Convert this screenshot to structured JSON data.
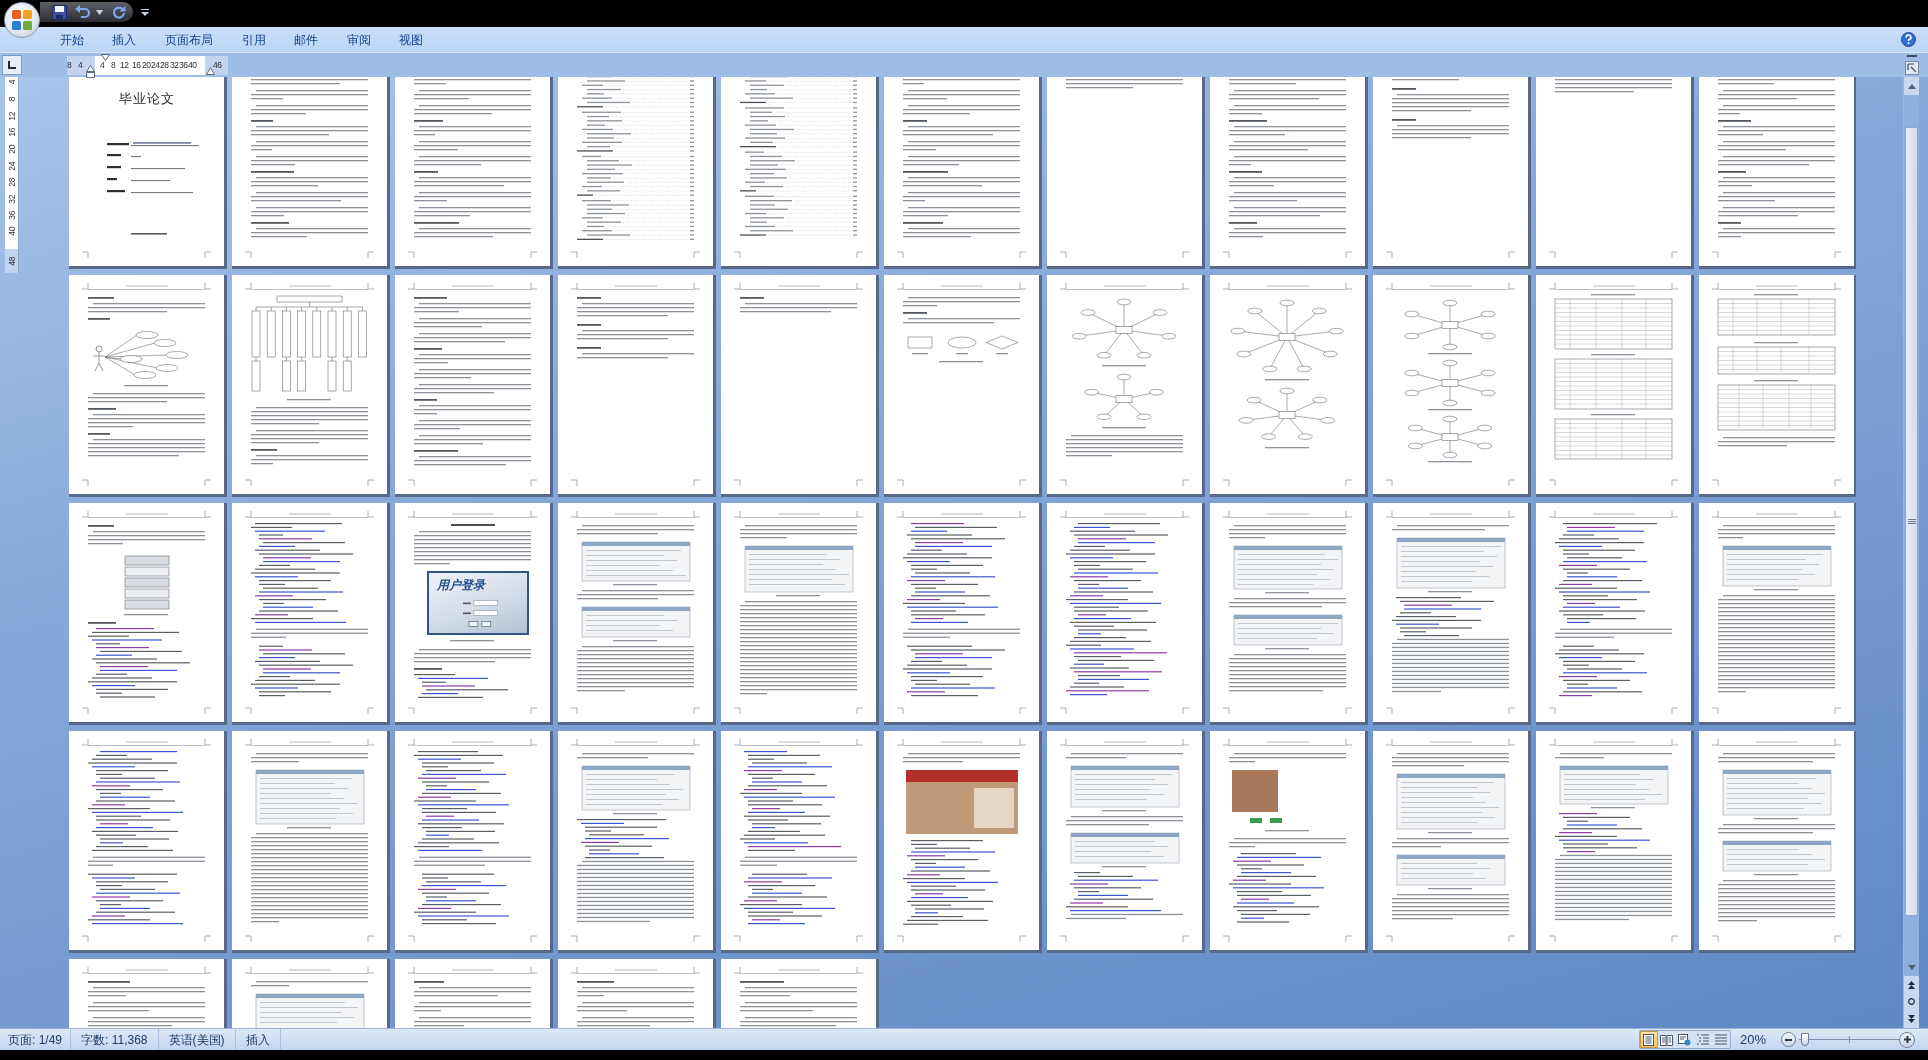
{
  "ribbon": {
    "tabs": [
      {
        "label": "开始",
        "selected": false
      },
      {
        "label": "插入",
        "selected": false
      },
      {
        "label": "页面布局",
        "selected": false
      },
      {
        "label": "引用",
        "selected": false
      },
      {
        "label": "邮件",
        "selected": false
      },
      {
        "label": "审阅",
        "selected": false
      },
      {
        "label": "视图",
        "selected": false
      }
    ]
  },
  "ruler": {
    "horizontal": [
      "8",
      "4",
      "4",
      "8",
      "12",
      "16",
      "20",
      "24",
      "28",
      "32",
      "36",
      "40",
      "46"
    ],
    "vertical": [
      "4",
      "8",
      "12",
      "16",
      "20",
      "24",
      "28",
      "32",
      "36",
      "40",
      "48"
    ]
  },
  "pages": [
    {
      "kind": "title",
      "title": "毕业论文"
    },
    {
      "kind": "text"
    },
    {
      "kind": "text"
    },
    {
      "kind": "toc"
    },
    {
      "kind": "toc"
    },
    {
      "kind": "text"
    },
    {
      "kind": "sparse"
    },
    {
      "kind": "text"
    },
    {
      "kind": "sparse"
    },
    {
      "kind": "sparse"
    },
    {
      "kind": "text"
    },
    {
      "kind": "usecase"
    },
    {
      "kind": "tree"
    },
    {
      "kind": "text"
    },
    {
      "kind": "sparse"
    },
    {
      "kind": "sparse"
    },
    {
      "kind": "shapes"
    },
    {
      "kind": "er"
    },
    {
      "kind": "er"
    },
    {
      "kind": "er"
    },
    {
      "kind": "table"
    },
    {
      "kind": "table"
    },
    {
      "kind": "stack"
    },
    {
      "kind": "code"
    },
    {
      "kind": "login",
      "screen_title": "用户登录"
    },
    {
      "kind": "screenshot"
    },
    {
      "kind": "screenshot"
    },
    {
      "kind": "code"
    },
    {
      "kind": "code"
    },
    {
      "kind": "screenshot"
    },
    {
      "kind": "screenshot"
    },
    {
      "kind": "code"
    },
    {
      "kind": "screenshot"
    },
    {
      "kind": "code"
    },
    {
      "kind": "screenshot"
    },
    {
      "kind": "code"
    },
    {
      "kind": "screenshot"
    },
    {
      "kind": "code"
    },
    {
      "kind": "photo"
    },
    {
      "kind": "screenshot"
    },
    {
      "kind": "photo"
    },
    {
      "kind": "screenshot"
    },
    {
      "kind": "screenshot"
    },
    {
      "kind": "screenshot"
    },
    {
      "kind": "text"
    },
    {
      "kind": "screenshot"
    },
    {
      "kind": "text"
    },
    {
      "kind": "text"
    },
    {
      "kind": "text"
    }
  ],
  "status_bar": {
    "page": "页面: 1/49",
    "words": "字数: 11,368",
    "language": "英语(美国)",
    "mode": "插入",
    "views": [
      {
        "kind": "print",
        "selected": true
      },
      {
        "kind": "reading",
        "selected": false
      },
      {
        "kind": "web",
        "selected": false
      },
      {
        "kind": "outline",
        "selected": false
      },
      {
        "kind": "draft",
        "selected": false
      }
    ],
    "zoom": "20%",
    "zoom_slider": {
      "level": 0.06
    }
  }
}
